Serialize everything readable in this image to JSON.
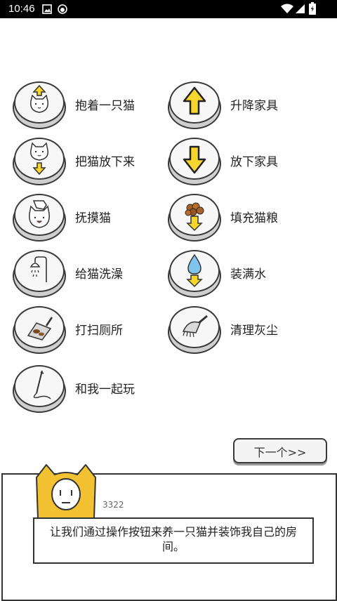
{
  "status_bar": {
    "time": "10:46",
    "icons": [
      "image-icon",
      "app-icon",
      "wifi-icon",
      "signal-icon",
      "battery-icon"
    ]
  },
  "actions": {
    "hold_cat": "抱着一只猫",
    "raise_furniture": "升降家具",
    "put_down_cat": "把猫放下来",
    "put_down_furniture": "放下家具",
    "pet_cat": "抚摸猫",
    "fill_food": "填充猫粮",
    "bathe_cat": "给猫洗澡",
    "fill_water": "装满水",
    "clean_litter": "打扫厕所",
    "clean_dust": "清理灰尘",
    "play_with_me": "和我一起玩"
  },
  "next_button": {
    "label": "下一个>>"
  },
  "dialog": {
    "speaker": "3322",
    "message": "让我们通过操作按钮来养一只猫并装饰我自己的房间。"
  },
  "colors": {
    "arrow_yellow": "#f6d52e",
    "mascot_yellow": "#f2c232",
    "button_rim": "#cfcfcf",
    "outline": "#3a3a3a"
  }
}
